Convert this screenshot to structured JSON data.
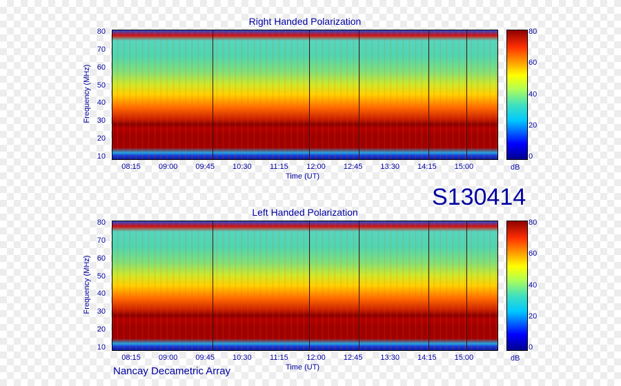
{
  "chart_data": [
    {
      "type": "heatmap",
      "title": "Right Handed Polarization",
      "xlabel": "Time (UT)",
      "ylabel": "Frequency (MHz)",
      "x_ticks": [
        "08:15",
        "09:00",
        "09:45",
        "10:30",
        "11:15",
        "12:00",
        "12:45",
        "13:30",
        "14:15",
        "15:00"
      ],
      "y_ticks": [
        10,
        20,
        30,
        40,
        50,
        60,
        70,
        80
      ],
      "ylim": [
        10,
        80
      ],
      "colorbar": {
        "label": "dB",
        "ticks": [
          0,
          20,
          40,
          60,
          80
        ],
        "range": [
          0,
          80
        ]
      }
    },
    {
      "type": "heatmap",
      "title": "Left Handed Polarization",
      "xlabel": "Time (UT)",
      "ylabel": "Frequency (MHz)",
      "x_ticks": [
        "08:15",
        "09:00",
        "09:45",
        "10:30",
        "11:15",
        "12:00",
        "12:45",
        "13:30",
        "14:15",
        "15:00"
      ],
      "y_ticks": [
        10,
        20,
        30,
        40,
        50,
        60,
        70,
        80
      ],
      "ylim": [
        10,
        80
      ],
      "colorbar": {
        "label": "dB",
        "ticks": [
          0,
          20,
          40,
          60,
          80
        ],
        "range": [
          0,
          80
        ]
      }
    }
  ],
  "date_label": "S130414",
  "footer": "Nancay Decametric Array"
}
